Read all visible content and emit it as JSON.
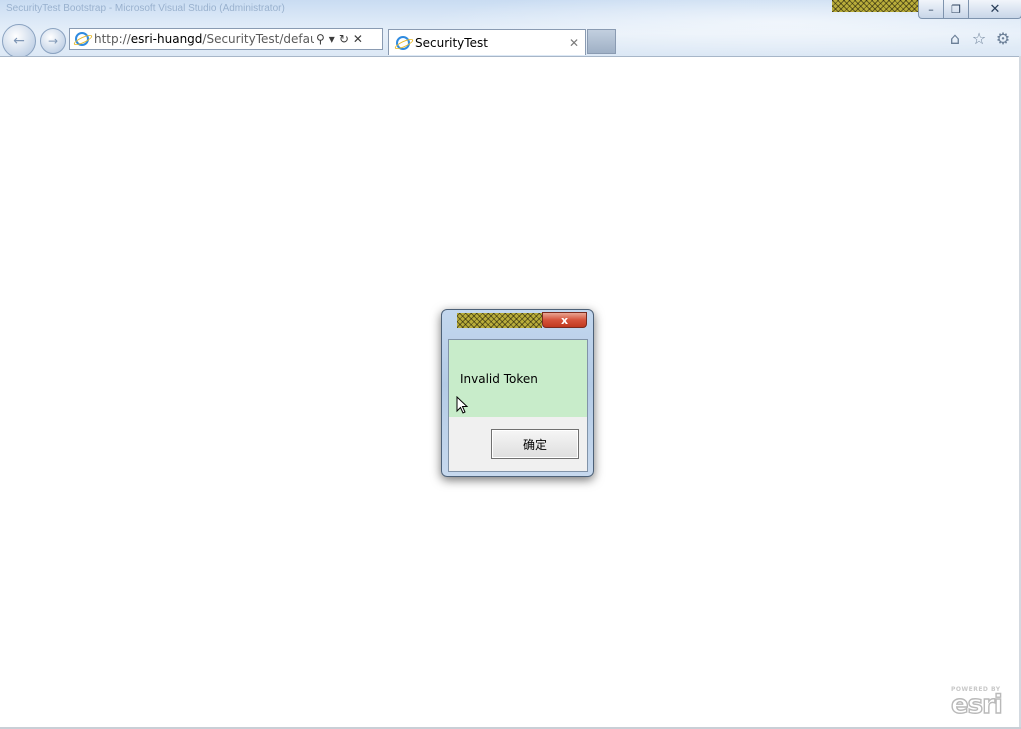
{
  "window": {
    "title_text": "SecurityTest Bootstrap - Microsoft Visual Studio (Administrator)",
    "minimize_glyph": "–",
    "restore_glyph": "❐",
    "close_glyph": "✕"
  },
  "nav": {
    "back_icon": "back-arrow-icon",
    "forward_icon": "forward-arrow-icon",
    "back_glyph": "←",
    "forward_glyph": "→"
  },
  "address": {
    "url_prefix": "http://",
    "url_host": "esri-huangd",
    "url_path": "/SecurityTest/defau",
    "search_glyph": "⚲",
    "dropdown_glyph": "▾",
    "refresh_glyph": "↻",
    "stop_glyph": "✕"
  },
  "tab": {
    "title": "SecurityTest",
    "close_glyph": "✕"
  },
  "toolbar": {
    "home_glyph": "⌂",
    "favorites_glyph": "☆",
    "tools_glyph": "⚙"
  },
  "dialog": {
    "message": "Invalid Token",
    "ok_label": "确定",
    "close_glyph": "x"
  },
  "logo": {
    "powered_by": "POWERED BY",
    "brand": "esri"
  }
}
